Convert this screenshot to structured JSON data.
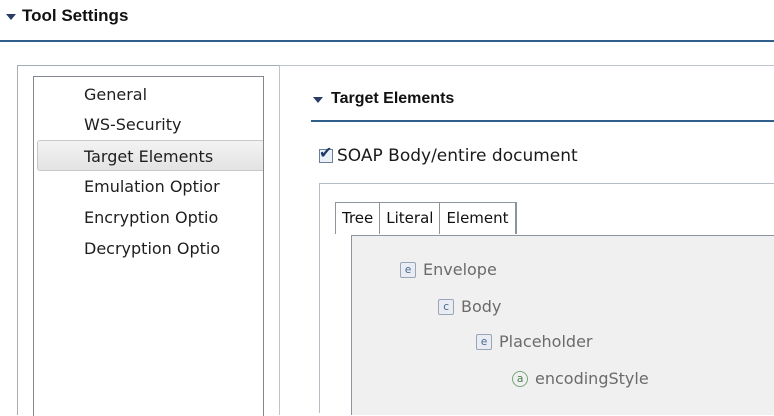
{
  "section": {
    "title": "Tool Settings"
  },
  "nav": {
    "items": [
      {
        "label": "General"
      },
      {
        "label": "WS-Security"
      },
      {
        "label": "Target Elements"
      },
      {
        "label": "Emulation Optior"
      },
      {
        "label": "Encryption Optio"
      },
      {
        "label": "Decryption Optio"
      }
    ],
    "selected_index": 2
  },
  "target_elements": {
    "title": "Target Elements",
    "soap_body_checkbox": {
      "label": "SOAP Body/entire document",
      "checked": true
    },
    "tabs": [
      {
        "label": "Tree"
      },
      {
        "label": "Literal"
      },
      {
        "label": "Element"
      }
    ],
    "active_tab": "Tree",
    "tree": [
      {
        "icon": "e",
        "label": "Envelope"
      },
      {
        "icon": "c",
        "label": "Body"
      },
      {
        "icon": "e",
        "label": "Placeholder"
      },
      {
        "icon": "a",
        "label": "encodingStyle"
      }
    ]
  }
}
